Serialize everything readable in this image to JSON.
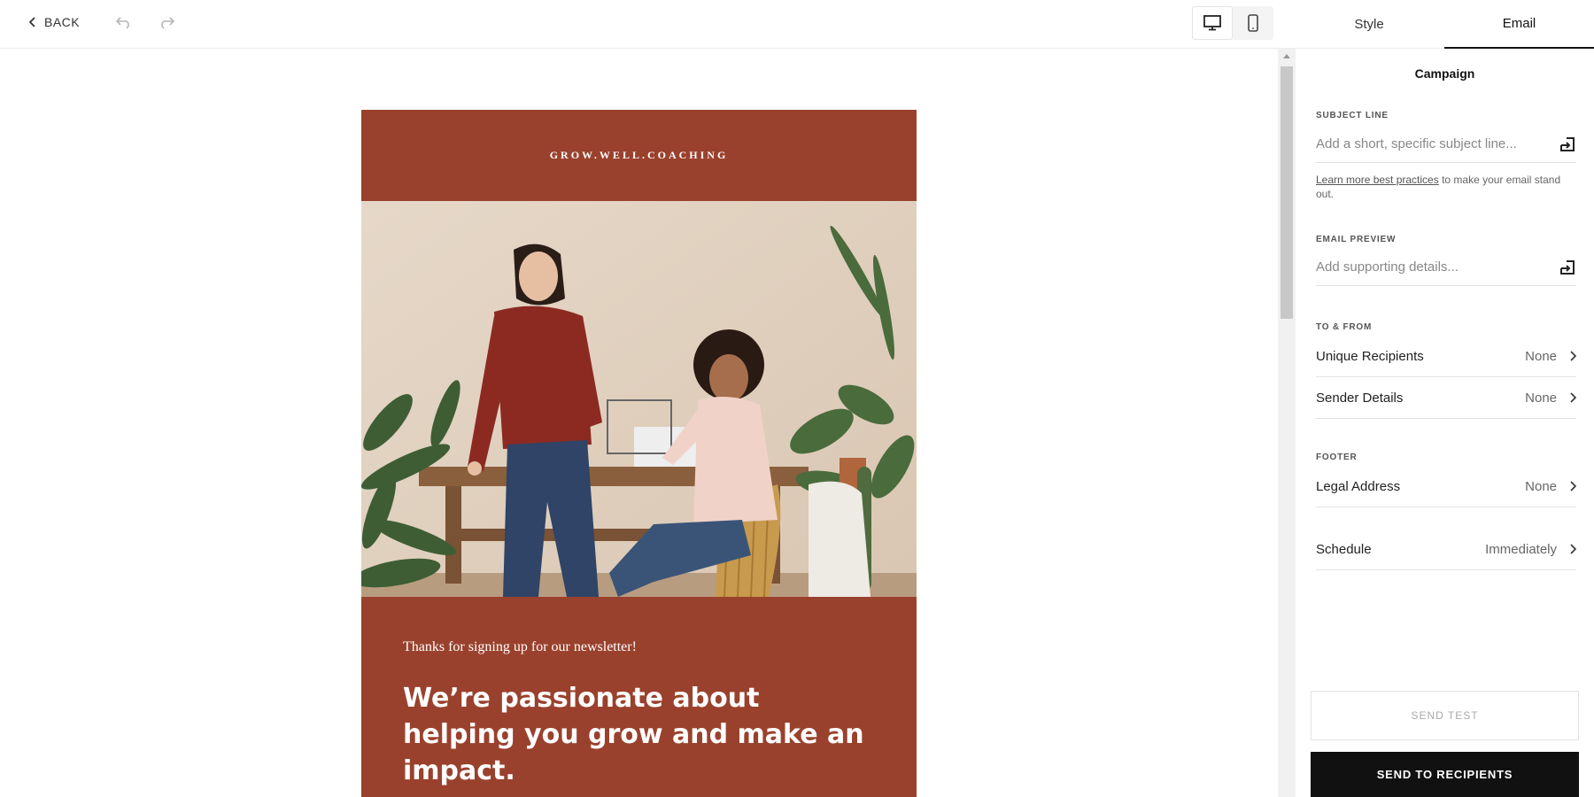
{
  "toolbar": {
    "back_label": "BACK",
    "back_icon": "chevron-left-icon",
    "undo_icon": "undo-icon",
    "redo_icon": "redo-icon",
    "view_modes": [
      "desktop",
      "mobile"
    ],
    "active_view": "desktop"
  },
  "tabs": [
    {
      "label": "Style",
      "active": false
    },
    {
      "label": "Email",
      "active": true
    }
  ],
  "email": {
    "brand": "GROW.WELL.COACHING",
    "intro": "Thanks for signing up for our newsletter!",
    "headline": "We’re passionate about helping you grow and make an impact.",
    "accent_color": "#9a412d"
  },
  "panel": {
    "title": "Campaign",
    "subject_line": {
      "label": "SUBJECT LINE",
      "placeholder": "Add a short, specific subject line..."
    },
    "help": {
      "link": "Learn more best practices",
      "text": " to make your email stand out."
    },
    "email_preview": {
      "label": "EMAIL PREVIEW",
      "placeholder": "Add supporting details..."
    },
    "to_from": {
      "label": "TO & FROM",
      "rows": [
        {
          "label": "Unique Recipients",
          "value": "None"
        },
        {
          "label": "Sender Details",
          "value": "None"
        }
      ]
    },
    "footer": {
      "label": "FOOTER",
      "rows": [
        {
          "label": "Legal Address",
          "value": "None"
        }
      ]
    },
    "schedule": {
      "label": "Schedule",
      "value": "Immediately"
    },
    "send_test": "SEND TEST",
    "send_recipients": "SEND TO RECIPIENTS"
  }
}
